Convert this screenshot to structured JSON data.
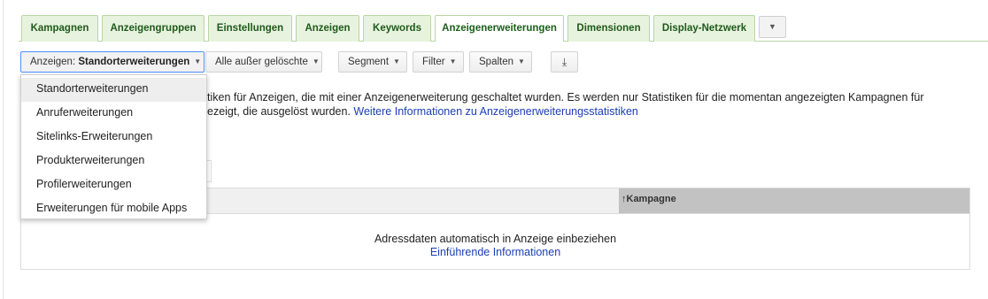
{
  "tabs": [
    {
      "label": "Kampagnen"
    },
    {
      "label": "Anzeigengruppen"
    },
    {
      "label": "Einstellungen"
    },
    {
      "label": "Anzeigen"
    },
    {
      "label": "Keywords"
    },
    {
      "label": "Anzeigenerweiterungen",
      "active": true
    },
    {
      "label": "Dimensionen"
    },
    {
      "label": "Display-Netzwerk"
    }
  ],
  "toolbar": {
    "view_prefix": "Anzeigen:",
    "view_value": "Standorterweiterungen",
    "status_filter": "Alle außer gelöschte",
    "segment": "Segment",
    "filter": "Filter",
    "columns": "Spalten",
    "download_icon": "download-icon"
  },
  "dropdown": {
    "items": [
      {
        "label": "Standorterweiterungen",
        "selected": true
      },
      {
        "label": "Anruferweiterungen"
      },
      {
        "label": "Sitelinks-Erweiterungen"
      },
      {
        "label": "Produkterweiterungen"
      },
      {
        "label": "Profilerweiterungen"
      },
      {
        "label": "Erweiterungen für mobile Apps"
      }
    ]
  },
  "info": {
    "line1": "tiken für Anzeigen, die mit einer Anzeigenerweiterung geschaltet wurden. Es werden nur Statistiken für die momentan angezeigten Kampagnen für",
    "line2": "ezeigt, die ausgelöst wurden.",
    "link": "Weitere Informationen zu Anzeigenerweiterungsstatistiken"
  },
  "table": {
    "column_kampagne": "Kampagne",
    "sort_icon": "arrow-up-icon",
    "empty_text": "Adressdaten automatisch in Anzeige einbeziehen",
    "empty_link": "Einführende Informationen"
  },
  "colors": {
    "tab_bg": "#e8f3df",
    "tab_border": "#b9d6a3",
    "tab_text": "#1e5a1a",
    "link": "#1a3eb5",
    "focus": "#4d90fe"
  }
}
